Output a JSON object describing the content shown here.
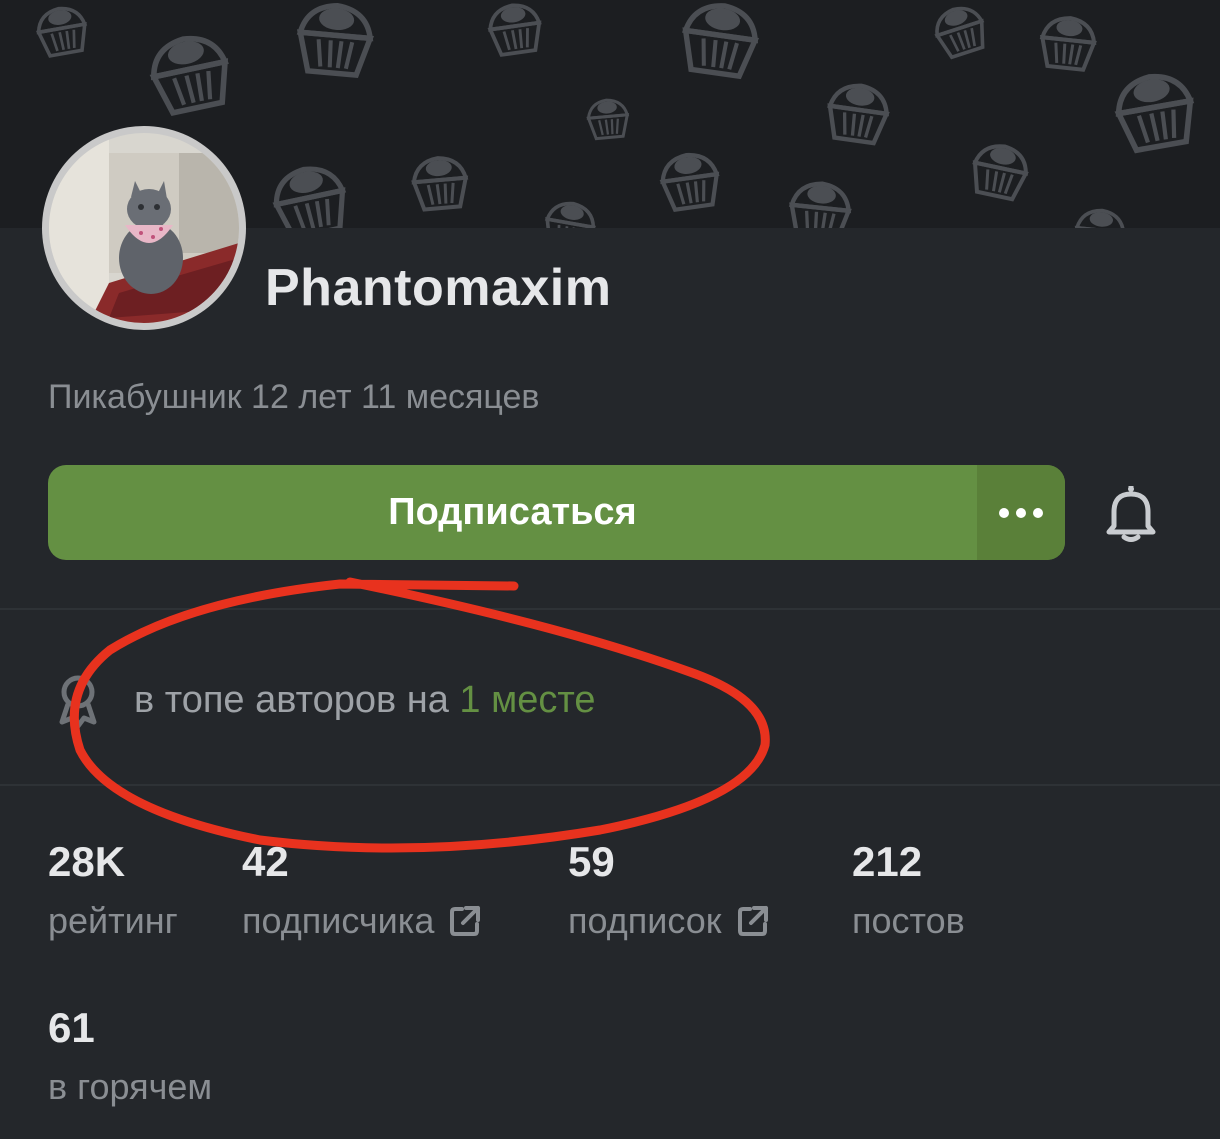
{
  "profile": {
    "username": "Phantomaxim",
    "tenure": "Пикабушник 12 лет 11 месяцев"
  },
  "actions": {
    "subscribe_label": "Подписаться",
    "more_icon": "more-dots-icon",
    "bell_icon": "bell-icon"
  },
  "top_authors": {
    "text": "в топе авторов на",
    "place": "1 месте",
    "icon": "award-icon"
  },
  "stats": [
    {
      "value": "28K",
      "label": "рейтинг"
    },
    {
      "value": "42",
      "label": "подписчика",
      "icon": "external-link-icon"
    },
    {
      "value": "59",
      "label": "подписок",
      "icon": "external-link-icon"
    },
    {
      "value": "212",
      "label": "постов"
    },
    {
      "value": "61",
      "label": "в горячем"
    }
  ],
  "colors": {
    "accent": "#649043",
    "background": "#24272b",
    "annotation": "#e8321e"
  }
}
